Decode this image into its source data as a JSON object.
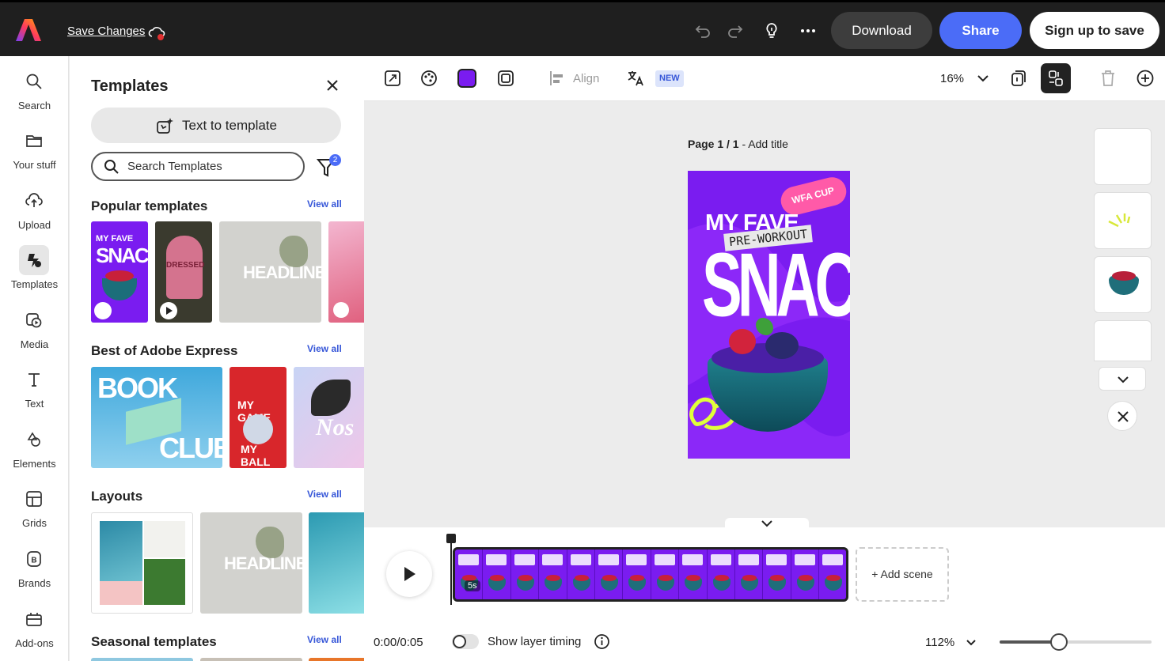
{
  "header": {
    "save_label": "Save Changes",
    "download_label": "Download",
    "share_label": "Share",
    "signup_label": "Sign up to save",
    "icons": [
      "adobe-logo-icon",
      "cloud-alert-icon",
      "undo-icon",
      "redo-icon",
      "lightbulb-icon",
      "more-icon"
    ]
  },
  "rail": {
    "items": [
      {
        "label": "Search",
        "icon": "search-icon"
      },
      {
        "label": "Your stuff",
        "icon": "folder-icon"
      },
      {
        "label": "Upload",
        "icon": "upload-cloud-icon"
      },
      {
        "label": "Templates",
        "icon": "templates-icon",
        "active": true
      },
      {
        "label": "Media",
        "icon": "media-icon"
      },
      {
        "label": "Text",
        "icon": "text-icon"
      },
      {
        "label": "Elements",
        "icon": "elements-icon"
      },
      {
        "label": "Grids",
        "icon": "grids-icon"
      },
      {
        "label": "Brands",
        "icon": "brands-icon"
      },
      {
        "label": "Add-ons",
        "icon": "addons-icon"
      }
    ]
  },
  "panel": {
    "title": "Templates",
    "t2t_label": "Text to template",
    "search_placeholder": "Search Templates",
    "filter_count": "2",
    "view_all": "View all",
    "sections": {
      "popular": "Popular templates",
      "best": "Best of Adobe Express",
      "layouts": "Layouts",
      "seasonal": "Seasonal templates"
    },
    "thumbs": {
      "snack_line1": "MY FAVE",
      "snack_line2": "SNACK",
      "dressed": "DRESSED",
      "headline": "HEADLINE",
      "book": "BOOK",
      "club": "CLUB",
      "game_line1": "MY GAME",
      "game_line2": "MY BALL",
      "nos": "Nos"
    }
  },
  "toolbar": {
    "align_label": "Align",
    "new_badge": "NEW",
    "zoom": "16%"
  },
  "canvas": {
    "page_num": "Page 1 / 1",
    "page_title": "Add title",
    "design": {
      "badge": "WFA CUP",
      "line1": "MY FAVE",
      "line2": "PRE-WORKOUT",
      "line3": "SNACK"
    }
  },
  "timeline": {
    "duration_badge": "5s",
    "add_scene_label": "+ Add scene",
    "time": "0:00/0:05",
    "layer_timing_label": "Show layer timing",
    "zoom": "112%",
    "zoom_slider_fraction": 0.39
  },
  "colors": {
    "accent_blue": "#4b6cf7",
    "design_purple": "#7a1cf0",
    "topbar": "#1f1f1f"
  }
}
